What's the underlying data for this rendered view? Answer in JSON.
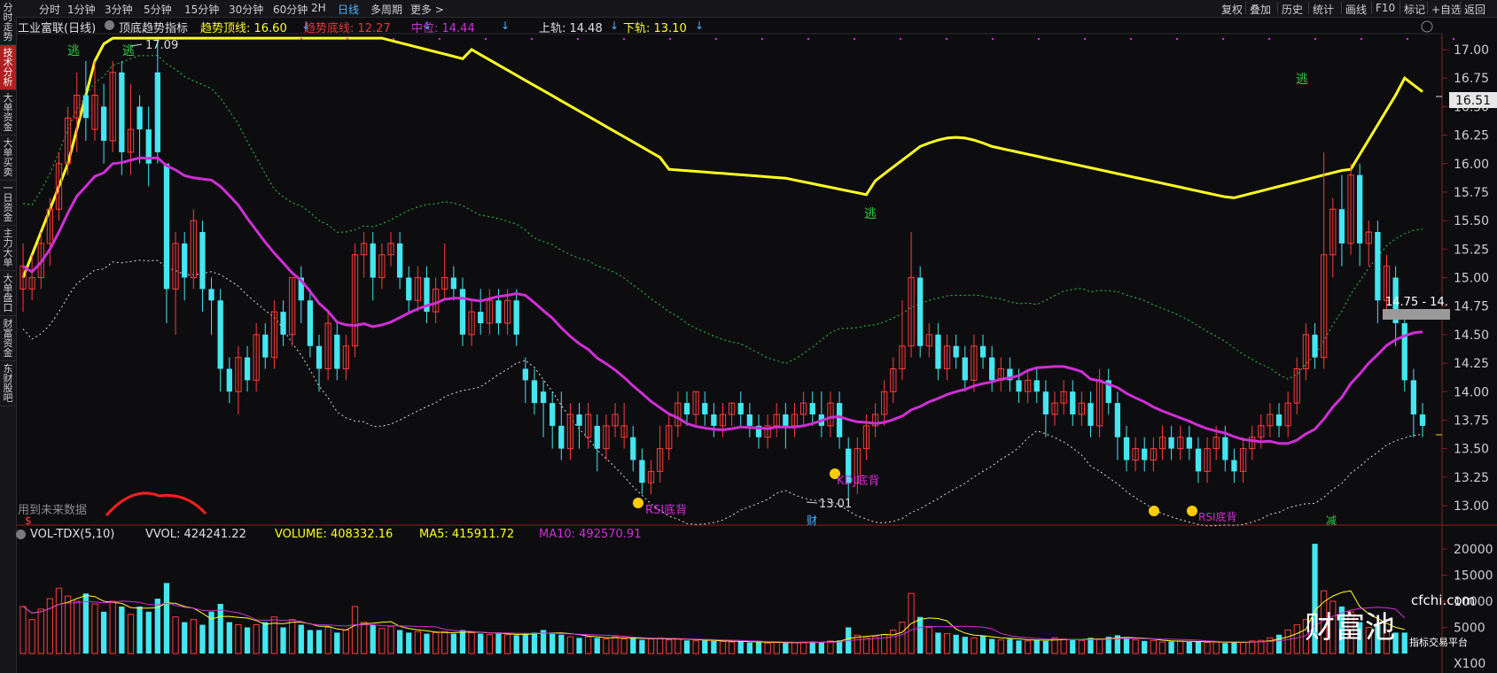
{
  "vnav": {
    "items": [
      {
        "label": "分时走势",
        "active": false
      },
      {
        "label": "技术分析",
        "active": true
      },
      {
        "label": "大单资金",
        "active": false
      },
      {
        "label": "大单买卖",
        "active": false
      },
      {
        "label": "一日资金",
        "active": false
      },
      {
        "label": "主力大单",
        "active": false
      },
      {
        "label": "大单盘口",
        "active": false
      },
      {
        "label": "财富资金",
        "active": false
      },
      {
        "label": "东财股吧",
        "active": false
      }
    ]
  },
  "periods": [
    "分时",
    "1分钟",
    "3分钟",
    "5分钟",
    "15分钟",
    "30分钟",
    "60分钟",
    "2H",
    "日线",
    "多周期",
    "更多 >"
  ],
  "active_period": "日线",
  "toolbar": [
    "复权",
    "叠加",
    "历史",
    "统计",
    "画线",
    "F10",
    "标记",
    "+自选",
    "返回"
  ],
  "indicator": {
    "stock_name": "工业富联(日线)",
    "indicator_name": "顶底趋势指标",
    "top_label": "趋势顶线: 16.60",
    "bottom_label": "趋势底线: 12.27",
    "mid_label": "中位: 14.44",
    "upper_label": "上轨: 14.48",
    "lower_label": "下轨: 13.10",
    "future_data_note": "用到未来数据"
  },
  "volume_indicator": {
    "name": "VOL-TDX(5,10)",
    "vvol": "VVOL: 424241.22",
    "volume": "VOLUME: 408332.16",
    "ma5": "MA5: 415911.72",
    "ma10": "MA10: 492570.91"
  },
  "price_axis": [
    "17.00",
    "16.75",
    "16.50",
    "16.25",
    "16.00",
    "15.75",
    "15.50",
    "15.25",
    "15.00",
    "14.75",
    "14.50",
    "14.25",
    "14.00",
    "13.75",
    "13.50",
    "13.25",
    "13.00"
  ],
  "volume_axis": [
    "20000",
    "15000",
    "10000",
    "5000",
    "X100"
  ],
  "current_price_tag": "16.51",
  "range_tag": "14.75 - 14.",
  "annotations": {
    "high_label": "17.09",
    "low_label": "13.01",
    "escape": "逃",
    "rsi": "RSI底背",
    "kdj": "KDJ底背",
    "cai": "财",
    "jian": "减",
    "s_mark": "$"
  },
  "watermark": {
    "brand": "财富池",
    "domain": "cfchi.com",
    "tagline": "指标交易平台"
  },
  "colors": {
    "up": "#ff3b3b",
    "down": "#44e6f0",
    "yellow": "#ffff22",
    "purple": "#d02ed6",
    "green": "#2ecc40",
    "white": "#dcdcdc",
    "bg": "#0d0d10"
  },
  "chart_data": {
    "type": "candlestick",
    "ylim": [
      12.9,
      17.1
    ],
    "candles": [
      [
        14.9,
        15.1,
        14.7,
        15.3
      ],
      [
        14.9,
        15.0,
        14.8,
        15.2
      ],
      [
        15.0,
        15.3,
        14.9,
        15.4
      ],
      [
        15.3,
        15.6,
        15.1,
        15.7
      ],
      [
        15.6,
        16.0,
        15.5,
        16.1
      ],
      [
        16.0,
        16.4,
        15.9,
        16.5
      ],
      [
        16.4,
        16.6,
        16.1,
        16.8
      ],
      [
        16.6,
        16.4,
        16.2,
        16.9
      ],
      [
        16.3,
        16.6,
        16.2,
        16.9
      ],
      [
        16.5,
        16.2,
        16.0,
        16.7
      ],
      [
        16.2,
        16.8,
        16.1,
        16.9
      ],
      [
        16.8,
        16.1,
        15.9,
        16.9
      ],
      [
        16.1,
        16.3,
        15.9,
        16.7
      ],
      [
        16.5,
        16.3,
        16.0,
        16.6
      ],
      [
        16.3,
        16.0,
        15.8,
        16.5
      ],
      [
        16.8,
        16.1,
        16.0,
        17.09
      ],
      [
        16.0,
        14.9,
        14.6,
        16.0
      ],
      [
        14.9,
        15.3,
        14.5,
        15.4
      ],
      [
        15.3,
        15.0,
        14.8,
        15.4
      ],
      [
        15.0,
        15.5,
        14.9,
        15.6
      ],
      [
        15.4,
        14.9,
        14.7,
        15.5
      ],
      [
        14.9,
        14.8,
        14.5,
        15.0
      ],
      [
        14.8,
        14.2,
        14.0,
        14.9
      ],
      [
        14.2,
        14.0,
        13.9,
        14.3
      ],
      [
        14.0,
        14.3,
        13.8,
        14.4
      ],
      [
        14.3,
        14.1,
        14.0,
        14.4
      ],
      [
        14.1,
        14.5,
        14.0,
        14.6
      ],
      [
        14.5,
        14.3,
        14.2,
        14.6
      ],
      [
        14.3,
        14.7,
        14.2,
        14.8
      ],
      [
        14.7,
        14.5,
        14.4,
        14.8
      ],
      [
        14.5,
        15.0,
        14.4,
        15.0
      ],
      [
        15.0,
        14.8,
        14.6,
        15.1
      ],
      [
        14.8,
        14.4,
        14.3,
        14.9
      ],
      [
        14.4,
        14.2,
        14.0,
        14.5
      ],
      [
        14.2,
        14.6,
        14.1,
        14.7
      ],
      [
        14.5,
        14.2,
        14.1,
        14.6
      ],
      [
        14.2,
        14.4,
        14.1,
        14.5
      ],
      [
        14.4,
        15.2,
        14.3,
        15.3
      ],
      [
        15.2,
        15.3,
        15.0,
        15.4
      ],
      [
        15.3,
        15.0,
        14.8,
        15.4
      ],
      [
        15.0,
        15.2,
        14.9,
        15.3
      ],
      [
        15.2,
        15.3,
        15.1,
        15.4
      ],
      [
        15.3,
        15.0,
        14.9,
        15.4
      ],
      [
        15.0,
        14.8,
        14.7,
        15.1
      ],
      [
        14.8,
        15.0,
        14.7,
        15.1
      ],
      [
        15.0,
        14.7,
        14.6,
        15.1
      ],
      [
        14.7,
        14.9,
        14.6,
        15.0
      ],
      [
        14.9,
        15.0,
        14.8,
        15.3
      ],
      [
        15.0,
        14.9,
        14.8,
        15.1
      ],
      [
        14.9,
        14.5,
        14.4,
        15.0
      ],
      [
        14.5,
        14.7,
        14.4,
        14.8
      ],
      [
        14.7,
        14.6,
        14.5,
        14.9
      ],
      [
        14.6,
        14.8,
        14.5,
        14.9
      ],
      [
        14.8,
        14.6,
        14.5,
        14.9
      ],
      [
        14.6,
        14.8,
        14.5,
        14.9
      ],
      [
        14.8,
        14.5,
        14.4,
        14.9
      ],
      [
        14.2,
        14.1,
        13.9,
        14.3
      ],
      [
        14.1,
        13.9,
        13.8,
        14.2
      ],
      [
        14.0,
        13.9,
        13.6,
        14.1
      ],
      [
        13.9,
        13.7,
        13.5,
        14.0
      ],
      [
        13.7,
        13.5,
        13.4,
        14.0
      ],
      [
        13.5,
        13.8,
        13.4,
        13.9
      ],
      [
        13.8,
        13.7,
        13.5,
        13.9
      ],
      [
        13.6,
        13.8,
        13.5,
        13.9
      ],
      [
        13.7,
        13.5,
        13.3,
        13.8
      ],
      [
        13.5,
        13.7,
        13.4,
        13.8
      ],
      [
        13.7,
        13.8,
        13.6,
        13.9
      ],
      [
        13.6,
        13.7,
        13.5,
        13.9
      ],
      [
        13.6,
        13.4,
        13.3,
        13.7
      ],
      [
        13.4,
        13.2,
        13.1,
        13.5
      ],
      [
        13.2,
        13.3,
        13.1,
        13.4
      ],
      [
        13.3,
        13.5,
        13.2,
        13.7
      ],
      [
        13.5,
        13.7,
        13.4,
        13.8
      ],
      [
        13.7,
        13.9,
        13.6,
        14.0
      ],
      [
        13.9,
        13.8,
        13.7,
        14.0
      ],
      [
        13.8,
        14.0,
        13.7,
        14.0
      ],
      [
        13.9,
        13.8,
        13.7,
        14.0
      ],
      [
        13.8,
        13.7,
        13.6,
        13.9
      ],
      [
        13.7,
        13.8,
        13.6,
        13.9
      ],
      [
        13.8,
        13.9,
        13.7,
        13.9
      ],
      [
        13.9,
        13.8,
        13.7,
        14.0
      ],
      [
        13.8,
        13.7,
        13.6,
        13.9
      ],
      [
        13.7,
        13.6,
        13.5,
        13.8
      ],
      [
        13.6,
        13.7,
        13.5,
        13.8
      ],
      [
        13.7,
        13.8,
        13.6,
        13.9
      ],
      [
        13.8,
        13.7,
        13.5,
        13.9
      ],
      [
        13.7,
        13.8,
        13.6,
        13.9
      ],
      [
        13.8,
        13.9,
        13.7,
        14.0
      ],
      [
        13.9,
        13.8,
        13.7,
        14.0
      ],
      [
        13.8,
        13.7,
        13.6,
        14.0
      ],
      [
        13.7,
        13.9,
        13.6,
        14.0
      ],
      [
        13.9,
        13.6,
        13.5,
        14.0
      ],
      [
        13.5,
        13.2,
        13.01,
        13.6
      ],
      [
        13.2,
        13.5,
        13.1,
        13.6
      ],
      [
        13.5,
        13.7,
        13.4,
        13.8
      ],
      [
        13.7,
        13.8,
        13.6,
        13.9
      ],
      [
        13.8,
        14.0,
        13.7,
        14.1
      ],
      [
        14.0,
        14.2,
        13.9,
        14.3
      ],
      [
        14.2,
        14.4,
        14.1,
        14.8
      ],
      [
        14.4,
        15.0,
        14.3,
        15.4
      ],
      [
        15.0,
        14.4,
        14.3,
        15.1
      ],
      [
        14.4,
        14.5,
        14.3,
        14.6
      ],
      [
        14.5,
        14.2,
        14.1,
        14.6
      ],
      [
        14.2,
        14.4,
        14.1,
        14.5
      ],
      [
        14.4,
        14.3,
        14.2,
        14.5
      ],
      [
        14.3,
        14.1,
        14.0,
        14.4
      ],
      [
        14.1,
        14.4,
        14.0,
        14.5
      ],
      [
        14.4,
        14.3,
        14.2,
        14.5
      ],
      [
        14.3,
        14.1,
        14.0,
        14.4
      ],
      [
        14.1,
        14.2,
        14.0,
        14.3
      ],
      [
        14.2,
        14.1,
        14.0,
        14.3
      ],
      [
        14.1,
        14.0,
        13.9,
        14.2
      ],
      [
        14.0,
        14.1,
        13.9,
        14.2
      ],
      [
        14.1,
        14.0,
        13.9,
        14.2
      ],
      [
        14.0,
        13.8,
        13.6,
        14.1
      ],
      [
        13.8,
        13.9,
        13.7,
        14.0
      ],
      [
        13.9,
        14.0,
        13.8,
        14.1
      ],
      [
        14.0,
        13.8,
        13.7,
        14.1
      ],
      [
        13.8,
        13.9,
        13.7,
        14.0
      ],
      [
        13.9,
        13.7,
        13.6,
        14.0
      ],
      [
        13.7,
        14.1,
        13.6,
        14.2
      ],
      [
        14.1,
        13.9,
        13.8,
        14.2
      ],
      [
        13.9,
        13.6,
        13.4,
        14.0
      ],
      [
        13.6,
        13.4,
        13.3,
        13.7
      ],
      [
        13.4,
        13.5,
        13.3,
        13.6
      ],
      [
        13.5,
        13.4,
        13.3,
        13.6
      ],
      [
        13.4,
        13.5,
        13.3,
        13.6
      ],
      [
        13.5,
        13.6,
        13.4,
        13.7
      ],
      [
        13.6,
        13.5,
        13.4,
        13.7
      ],
      [
        13.5,
        13.6,
        13.4,
        13.7
      ],
      [
        13.6,
        13.5,
        13.4,
        13.7
      ],
      [
        13.5,
        13.3,
        13.2,
        13.6
      ],
      [
        13.3,
        13.5,
        13.2,
        13.6
      ],
      [
        13.5,
        13.6,
        13.4,
        13.7
      ],
      [
        13.6,
        13.4,
        13.3,
        13.7
      ],
      [
        13.4,
        13.3,
        13.2,
        13.5
      ],
      [
        13.3,
        13.5,
        13.2,
        13.6
      ],
      [
        13.5,
        13.6,
        13.4,
        13.7
      ],
      [
        13.6,
        13.7,
        13.5,
        13.8
      ],
      [
        13.7,
        13.8,
        13.6,
        13.9
      ],
      [
        13.8,
        13.7,
        13.6,
        13.9
      ],
      [
        13.7,
        13.9,
        13.6,
        14.0
      ],
      [
        13.9,
        14.2,
        13.8,
        14.3
      ],
      [
        14.2,
        14.5,
        14.1,
        14.6
      ],
      [
        14.5,
        14.3,
        14.2,
        14.6
      ],
      [
        14.3,
        15.2,
        14.2,
        16.1
      ],
      [
        15.2,
        15.6,
        15.0,
        15.7
      ],
      [
        15.6,
        15.3,
        15.1,
        15.9
      ],
      [
        15.3,
        15.9,
        15.2,
        16.0
      ],
      [
        15.9,
        15.3,
        15.1,
        16.0
      ],
      [
        15.3,
        15.4,
        15.1,
        15.5
      ],
      [
        15.4,
        14.8,
        14.6,
        15.5
      ],
      [
        14.8,
        15.1,
        14.7,
        15.2
      ],
      [
        15.0,
        14.6,
        14.4,
        15.1
      ],
      [
        14.6,
        14.1,
        14.0,
        14.7
      ],
      [
        14.1,
        13.8,
        13.6,
        14.2
      ],
      [
        13.8,
        13.7,
        13.6,
        13.9
      ]
    ],
    "volumes": [
      9000,
      6500,
      8500,
      10500,
      12500,
      11000,
      10000,
      11500,
      9500,
      8000,
      10000,
      9000,
      7500,
      9000,
      8000,
      10500,
      13500,
      7000,
      6000,
      6500,
      5500,
      8000,
      9500,
      6000,
      5500,
      5000,
      5500,
      6000,
      7000,
      5000,
      6500,
      5500,
      4500,
      4500,
      5000,
      4000,
      4500,
      9000,
      6000,
      5500,
      4800,
      5200,
      4500,
      4000,
      4200,
      3800,
      4000,
      4200,
      3800,
      4500,
      4000,
      3800,
      3600,
      3800,
      3600,
      3500,
      3800,
      4000,
      4500,
      3800,
      3600,
      3200,
      3000,
      3200,
      3000,
      2800,
      3200,
      2800,
      3000,
      2600,
      2800,
      3000,
      2600,
      2800,
      2500,
      2400,
      2500,
      2400,
      2300,
      2200,
      2300,
      2100,
      2200,
      2000,
      2100,
      2000,
      2100,
      2200,
      2300,
      2200,
      2400,
      2500,
      5000,
      3500,
      3000,
      3200,
      3600,
      4500,
      6000,
      11500,
      7000,
      5000,
      4000,
      3800,
      3600,
      3200,
      3000,
      3400,
      2800,
      2600,
      2800,
      2500,
      2400,
      2600,
      2400,
      3000,
      2800,
      2600,
      2500,
      3000,
      2800,
      3200,
      3500,
      3000,
      2600,
      2400,
      2500,
      2200,
      2300,
      2400,
      2200,
      2300,
      2100,
      2200,
      2000,
      2100,
      2200,
      2400,
      2500,
      3000,
      3600,
      4500,
      5500,
      6500,
      21000,
      12000,
      10000,
      9000,
      8000,
      6000,
      5000,
      5500,
      4500,
      4000,
      4000
    ]
  }
}
